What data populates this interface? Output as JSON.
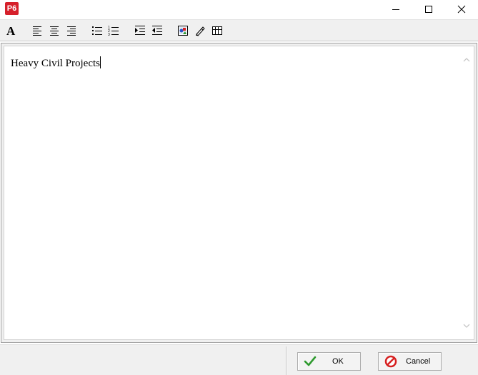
{
  "window": {
    "app_icon_label": "P6"
  },
  "toolbar": {
    "buttons": [
      {
        "name": "font"
      },
      {
        "name": "align-left"
      },
      {
        "name": "align-center"
      },
      {
        "name": "align-right"
      },
      {
        "name": "bulleted-list"
      },
      {
        "name": "numbered-list"
      },
      {
        "name": "increase-indent"
      },
      {
        "name": "decrease-indent"
      },
      {
        "name": "insert-picture"
      },
      {
        "name": "insert-link"
      },
      {
        "name": "insert-table"
      }
    ]
  },
  "editor": {
    "text": "Heavy Civil Projects"
  },
  "footer": {
    "ok_label": "OK",
    "cancel_label": "Cancel"
  },
  "colors": {
    "app_icon": "#d6202b",
    "ok_check": "#2e9a2e",
    "cancel_icon": "#d62020",
    "toolbar_bg": "#f0f0f0"
  }
}
